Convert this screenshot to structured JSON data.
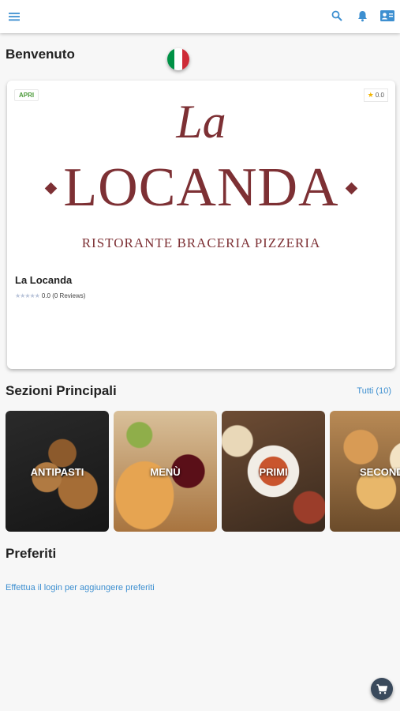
{
  "header": {
    "menu_icon": "hamburger-menu-icon",
    "search_icon": "search-icon",
    "notification_icon": "bell-icon",
    "profile_icon": "contact-card-icon",
    "accent": "#3d8fd0"
  },
  "welcome": {
    "title": "Benvenuto",
    "language_flag": "italy-flag-icon"
  },
  "restaurant": {
    "status": "APRI",
    "rating_badge": "0.0",
    "logo_script": "La",
    "logo_main": "LOCANDA",
    "logo_sub": "RISTORANTE BRACERIA PIZZERIA",
    "name": "La Locanda",
    "rating_stars": "★★★★★",
    "rating_text": "0.0 (0 Reviews)",
    "brand_color": "#7d3034"
  },
  "sections": {
    "title": "Sezioni Principali",
    "all_link": "Tutti (10)",
    "categories": [
      {
        "label": "ANTIPASTI"
      },
      {
        "label": "MENÙ"
      },
      {
        "label": "PRIMI"
      },
      {
        "label": "SECOND"
      }
    ]
  },
  "favorites": {
    "title": "Preferiti",
    "login_prompt": "Effettua il login per aggiungere preferiti"
  },
  "fab": {
    "icon": "cart-icon",
    "color": "#3a4a5c"
  }
}
